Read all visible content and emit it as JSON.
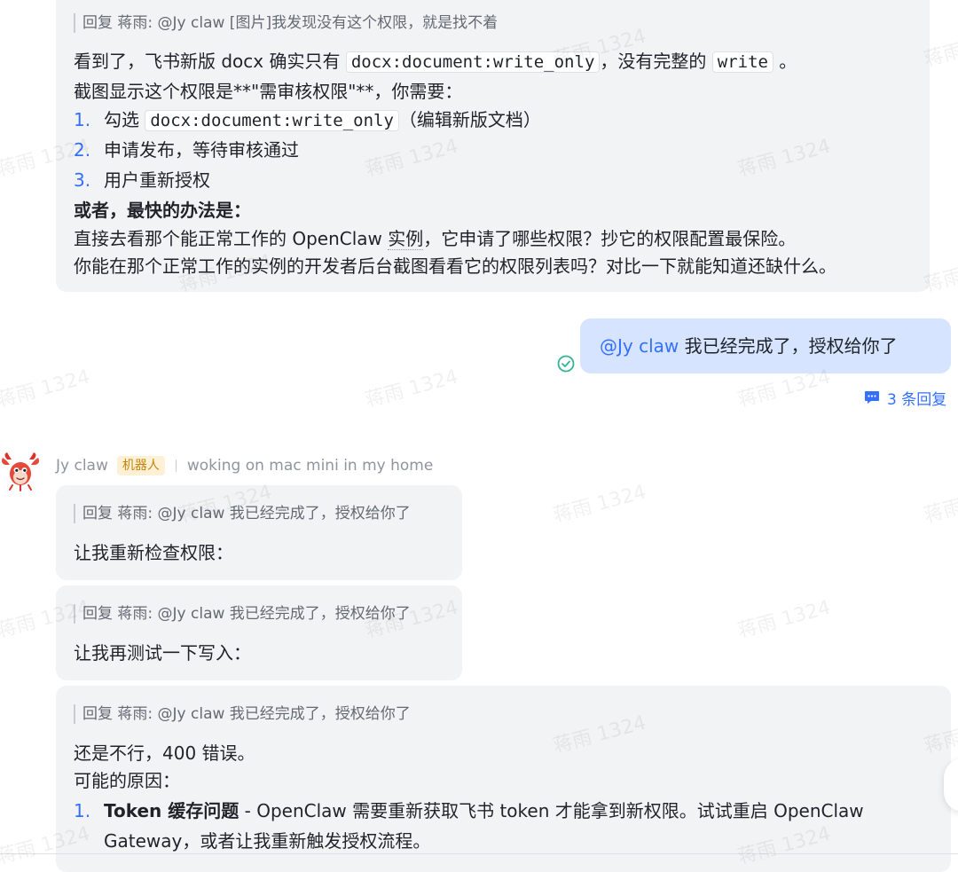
{
  "msg1": {
    "quote": "回复 蒋雨: @Jy claw [图片]我发现没有这个权限，就是找不着",
    "line1_a": "看到了，飞书新版 docx 确实只有 ",
    "line1_code1": "docx:document:write_only",
    "line1_b": "，没有完整的 ",
    "line1_code2": "write",
    "line1_c": " 。",
    "line2": "截图显示这个权限是**\"需审核权限\"**，你需要：",
    "items": [
      {
        "num": "1.",
        "text_a": "勾选 ",
        "code": "docx:document:write_only",
        "text_b": "（编辑新版文档）"
      },
      {
        "num": "2.",
        "text": "申请发布，等待审核通过"
      },
      {
        "num": "3.",
        "text": "用户重新授权"
      }
    ],
    "bold_line": "或者，最快的办法是：",
    "line6_a": "直接去看那个能正常工作的 OpenClaw ",
    "line6_u": "实例",
    "line6_b": "，它申请了哪些权限？抄它的权限配置最保险。",
    "line7": "你能在那个正常工作的实例的开发者后台截图看看它的权限列表吗？对比一下就能知道还缺什么。"
  },
  "my_msg": {
    "mention": "@Jy claw",
    "text": "  我已经完成了，授权给你了",
    "status_icon": "check-circle-icon",
    "replies": "3 条回复"
  },
  "bot": {
    "name": "Jy claw",
    "badge": "机器人",
    "status": "woking on mac mini in my home",
    "avatar_icon": "lobster-avatar"
  },
  "reply1": {
    "quote": "回复 蒋雨: @Jy claw 我已经完成了，授权给你了",
    "text": "让我重新检查权限："
  },
  "reply2": {
    "quote": "回复 蒋雨: @Jy claw 我已经完成了，授权给你了",
    "text": "让我再测试一下写入："
  },
  "reply3": {
    "quote": "回复 蒋雨: @Jy claw 我已经完成了，授权给你了",
    "line1": "还是不行，400 错误。",
    "line2": "可能的原因：",
    "item1_num": "1.",
    "item1_bold": "Token 缓存问题",
    "item1_text": " - OpenClaw 需要重新获取飞书 token 才能拿到新权限。试试重启 OpenClaw",
    "item1_text2": "Gateway，或者让我重新触发授权流程。"
  },
  "watermark": "蒋雨 1324",
  "colors": {
    "accent": "#3370ff",
    "bubble": "#f2f3f5",
    "my_bubble": "#d6e4ff",
    "badge_bg": "#fdf0d5",
    "badge_text": "#c4840b",
    "check": "#34b48f"
  }
}
